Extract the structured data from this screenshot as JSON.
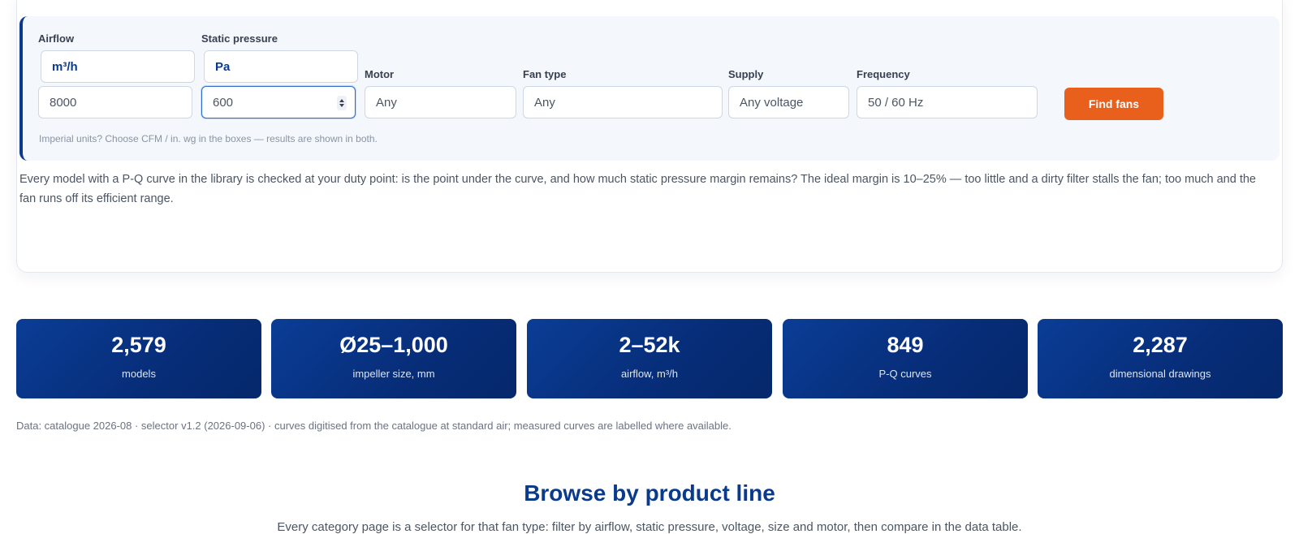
{
  "selector": {
    "airflow": {
      "label": "Airflow",
      "unit": "m³/h",
      "value": "8000"
    },
    "static_pressure": {
      "label": "Static pressure",
      "unit": "Pa",
      "value": "600"
    },
    "motor": {
      "label": "Motor",
      "value": "Any"
    },
    "fan_type": {
      "label": "Fan type",
      "value": "Any"
    },
    "supply": {
      "label": "Supply",
      "value": "Any voltage"
    },
    "frequency": {
      "label": "Frequency",
      "value": "50 / 60 Hz"
    },
    "find_label": "Find fans",
    "hint": "Imperial units? Choose CFM / in. wg in the boxes — results are shown in both."
  },
  "description": "Every model with a P-Q curve in the library is checked at your duty point: is the point under the curve, and how much static pressure margin remains? The ideal margin is 10–25% — too little and a dirty filter stalls the fan; too much and the fan runs off its efficient range.",
  "stats": [
    {
      "value": "2,579",
      "label": "models"
    },
    {
      "value": "Ø25–1,000",
      "label": "impeller size, mm"
    },
    {
      "value": "2–52k",
      "label": "airflow, m³/h"
    },
    {
      "value": "849",
      "label": "P-Q curves"
    },
    {
      "value": "2,287",
      "label": "dimensional drawings"
    }
  ],
  "meta": "Data: catalogue 2026-08 · selector v1.2 (2026-09-06) · curves digitised from the catalogue at standard air; measured curves are labelled where available.",
  "browse": {
    "title": "Browse by product line",
    "subtitle": "Every category page is a selector for that fan type: filter by airflow, static pressure, voltage, size and motor, then compare in the data table."
  },
  "colors": {
    "accent": "#0a3a8c",
    "button": "#e8601c",
    "panel": "#f4f7fc"
  }
}
